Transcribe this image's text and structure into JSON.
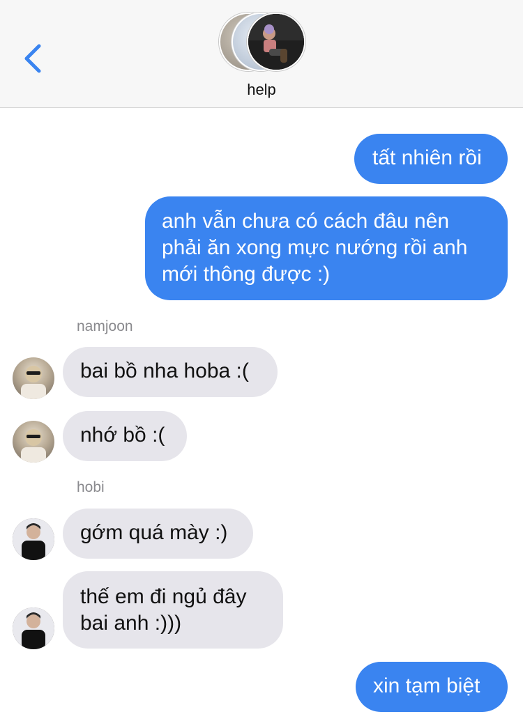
{
  "header": {
    "title": "help",
    "back_icon": "chevron-left-icon",
    "accent_color": "#3a84f0"
  },
  "messages": [
    {
      "direction": "outgoing",
      "text": "tất nhiên rồi"
    },
    {
      "direction": "outgoing",
      "lines": [
        "anh vẫn chưa có cách đâu nên",
        "phải ăn xong mực nướng rồi anh",
        "mới thông được :)"
      ]
    },
    {
      "direction": "incoming",
      "sender": "namjoon",
      "text": "bai bồ nha hoba :("
    },
    {
      "direction": "incoming",
      "sender": "namjoon",
      "text": "nhớ bồ :("
    },
    {
      "direction": "incoming",
      "sender": "hobi",
      "text": "gớm quá mày :)"
    },
    {
      "direction": "incoming",
      "sender": "hobi",
      "lines": [
        "thế em đi ngủ đây",
        "bai anh :)))"
      ]
    },
    {
      "direction": "outgoing",
      "text": "xin tạm biệt"
    }
  ],
  "senders": {
    "namjoon": "namjoon",
    "hobi": "hobi"
  },
  "colors": {
    "outgoing_bubble": "#3a84f0",
    "incoming_bubble": "#e6e5eb",
    "sender_label": "#8a8a8e"
  }
}
